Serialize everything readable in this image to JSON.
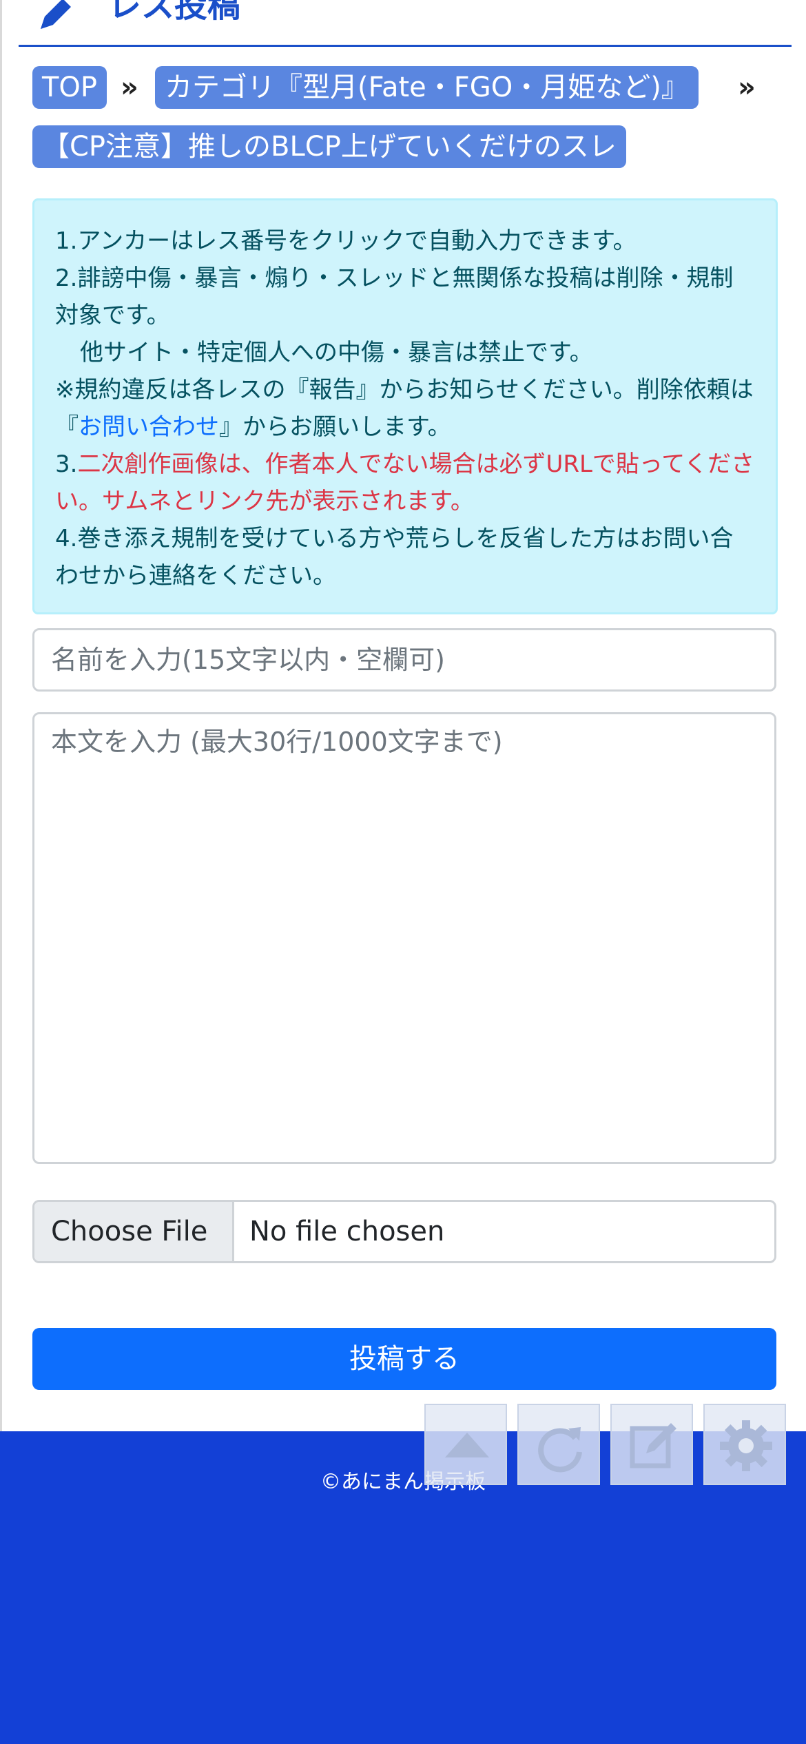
{
  "header": {
    "title": "レス投稿",
    "icon": "pen-icon"
  },
  "breadcrumb": {
    "top": "TOP",
    "separator": "»",
    "category": "カテゴリ『型月(Fate・FGO・月姫など)』",
    "thread": "【CP注意】推しのBLCP上げていくだけのスレ"
  },
  "notice": {
    "line1": "1.アンカーはレス番号をクリックで自動入力できます。",
    "line2": "2.誹謗中傷・暴言・煽り・スレッドと無関係な投稿は削除・規制対象です。",
    "line3": "他サイト・特定個人への中傷・暴言は禁止です。",
    "line4_pre": "※規約違反は各レスの『報告』からお知らせください。削除依頼は『",
    "line4_link": "お問い合わせ",
    "line4_post": "』からお願いします。",
    "line5_num": "3.",
    "line5_red": "二次創作画像は、作者本人でない場合は必ずURLで貼ってください。サムネとリンク先が表示されます。",
    "line6": "4.巻き添え規制を受けている方や荒らしを反省した方はお問い合わせから連絡をください。"
  },
  "form": {
    "name_placeholder": "名前を入力(15文字以内・空欄可)",
    "body_placeholder": "本文を入力 (最大30行/1000文字まで)",
    "file_button": "Choose File",
    "file_status": "No file chosen",
    "submit_label": "投稿する"
  },
  "footer": {
    "copyright": "©あにまん掲示板"
  },
  "floating_buttons": [
    "scroll-top-icon",
    "reload-icon",
    "edit-icon",
    "gear-icon"
  ],
  "colors": {
    "accent": "#1a4fc9",
    "breadcrumb_bg": "#5a86e0",
    "notice_bg": "#cff4fc",
    "notice_text": "#055160",
    "warning_red": "#dc3545",
    "link": "#0d6efd",
    "submit_bg": "#0d6efd",
    "footer_bg": "#1340d6"
  }
}
